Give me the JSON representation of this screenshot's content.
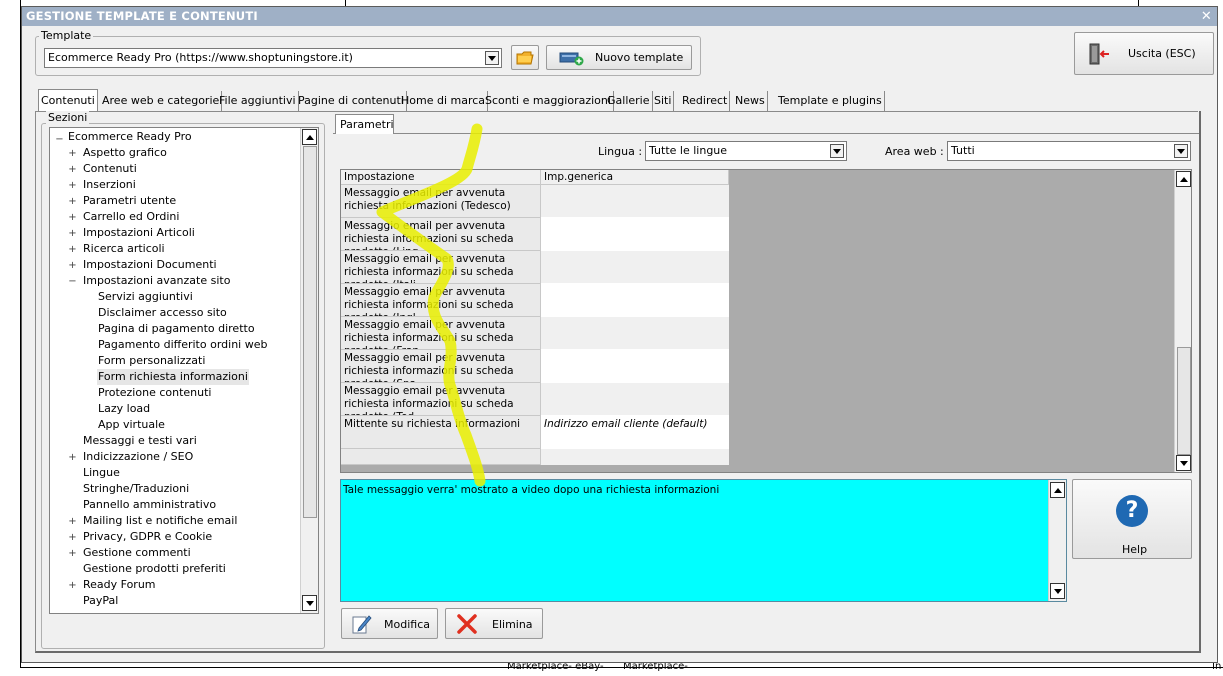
{
  "window": {
    "title": "GESTIONE TEMPLATE E CONTENUTI",
    "close_glyph": "✕"
  },
  "template_group": {
    "label": "Template",
    "selected": "Ecommerce Ready Pro (https://www.shoptuningstore.it)",
    "new_template_label": "Nuovo template"
  },
  "exit_button": {
    "label": "Uscita (ESC)"
  },
  "tabs": [
    "Contenuti",
    "Aree web e categorie",
    "File aggiuntivi",
    "Pagine di contenuti",
    "Home di marca",
    "Sconti e maggiorazioni",
    "Gallerie",
    "Siti",
    "Redirect",
    "News",
    "Template e plugins"
  ],
  "sections": {
    "label": "Sezioni",
    "root": "Ecommerce Ready Pro",
    "items": [
      {
        "label": "Aspetto grafico",
        "level": 1,
        "exp": "+"
      },
      {
        "label": "Contenuti",
        "level": 1,
        "exp": "+"
      },
      {
        "label": "Inserzioni",
        "level": 1,
        "exp": "+"
      },
      {
        "label": "Parametri utente",
        "level": 1,
        "exp": "+"
      },
      {
        "label": "Carrello ed Ordini",
        "level": 1,
        "exp": "+"
      },
      {
        "label": "Impostazioni Articoli",
        "level": 1,
        "exp": "+"
      },
      {
        "label": "Ricerca articoli",
        "level": 1,
        "exp": "+"
      },
      {
        "label": "Impostazioni Documenti",
        "level": 1,
        "exp": "+"
      },
      {
        "label": "Impostazioni avanzate sito",
        "level": 1,
        "exp": "-"
      },
      {
        "label": "Servizi aggiuntivi",
        "level": 2,
        "exp": ""
      },
      {
        "label": "Disclaimer accesso sito",
        "level": 2,
        "exp": ""
      },
      {
        "label": "Pagina di pagamento diretto",
        "level": 2,
        "exp": ""
      },
      {
        "label": "Pagamento differito ordini web",
        "level": 2,
        "exp": ""
      },
      {
        "label": "Form personalizzati",
        "level": 2,
        "exp": ""
      },
      {
        "label": "Form richiesta informazioni",
        "level": 2,
        "exp": "",
        "selected": true
      },
      {
        "label": "Protezione contenuti",
        "level": 2,
        "exp": ""
      },
      {
        "label": "Lazy load",
        "level": 2,
        "exp": ""
      },
      {
        "label": "App virtuale",
        "level": 2,
        "exp": ""
      },
      {
        "label": "Messaggi e testi vari",
        "level": 1,
        "exp": ""
      },
      {
        "label": "Indicizzazione / SEO",
        "level": 1,
        "exp": "+"
      },
      {
        "label": "Lingue",
        "level": 1,
        "exp": ""
      },
      {
        "label": "Stringhe/Traduzioni",
        "level": 1,
        "exp": ""
      },
      {
        "label": "Pannello amministrativo",
        "level": 1,
        "exp": ""
      },
      {
        "label": "Mailing list e notifiche email",
        "level": 1,
        "exp": "+"
      },
      {
        "label": "Privacy, GDPR e Cookie",
        "level": 1,
        "exp": "+"
      },
      {
        "label": "Gestione commenti",
        "level": 1,
        "exp": "+"
      },
      {
        "label": "Gestione prodotti preferiti",
        "level": 1,
        "exp": ""
      },
      {
        "label": "Ready Forum",
        "level": 1,
        "exp": "+"
      },
      {
        "label": "PayPal",
        "level": 1,
        "exp": ""
      }
    ]
  },
  "params_tab": {
    "label": "Parametri"
  },
  "filters": {
    "lingua_label": "Lingua :",
    "lingua_value": "Tutte le lingue",
    "area_label": "Area web :",
    "area_value": "Tutti"
  },
  "grid": {
    "col_setting": "Impostazione",
    "col_value": "Imp.generica",
    "rows": [
      {
        "setting": "Messaggio email per avvenuta richiesta informazioni (Tedesco)",
        "value": ""
      },
      {
        "setting": "Messaggio email per avvenuta richiesta informazioni su scheda prodotto (Ling…",
        "value": ""
      },
      {
        "setting": "Messaggio email per avvenuta richiesta informazioni su scheda prodotto (Itali…",
        "value": ""
      },
      {
        "setting": "Messaggio email per avvenuta richiesta informazioni su scheda prodotto (Ingl…",
        "value": ""
      },
      {
        "setting": "Messaggio email per avvenuta richiesta informazioni su scheda prodotto (Fran…",
        "value": ""
      },
      {
        "setting": "Messaggio email per avvenuta richiesta informazioni su scheda prodotto (Spa…",
        "value": ""
      },
      {
        "setting": "Messaggio email per avvenuta richiesta informazioni su scheda prodotto (Ted…",
        "value": ""
      },
      {
        "setting": "Mittente su richiesta informazioni",
        "value": "Indirizzo email cliente (default)"
      }
    ]
  },
  "description": {
    "text": "Tale messaggio verra' mostrato a video dopo una richiesta informazioni"
  },
  "help": {
    "label": "Help",
    "icon_glyph": "?"
  },
  "actions": {
    "modifica": "Modifica",
    "elimina": "Elimina"
  },
  "background": {
    "text1": "Marketplace- eBay-",
    "text2": "Marketplace-",
    "text3": "In"
  },
  "colors": {
    "title_bar": "#9fb0c6",
    "description_bg": "#00ffff",
    "highlight": "#e9ee00",
    "help_icon": "#1f69b3",
    "delete_icon": "#e03020"
  }
}
